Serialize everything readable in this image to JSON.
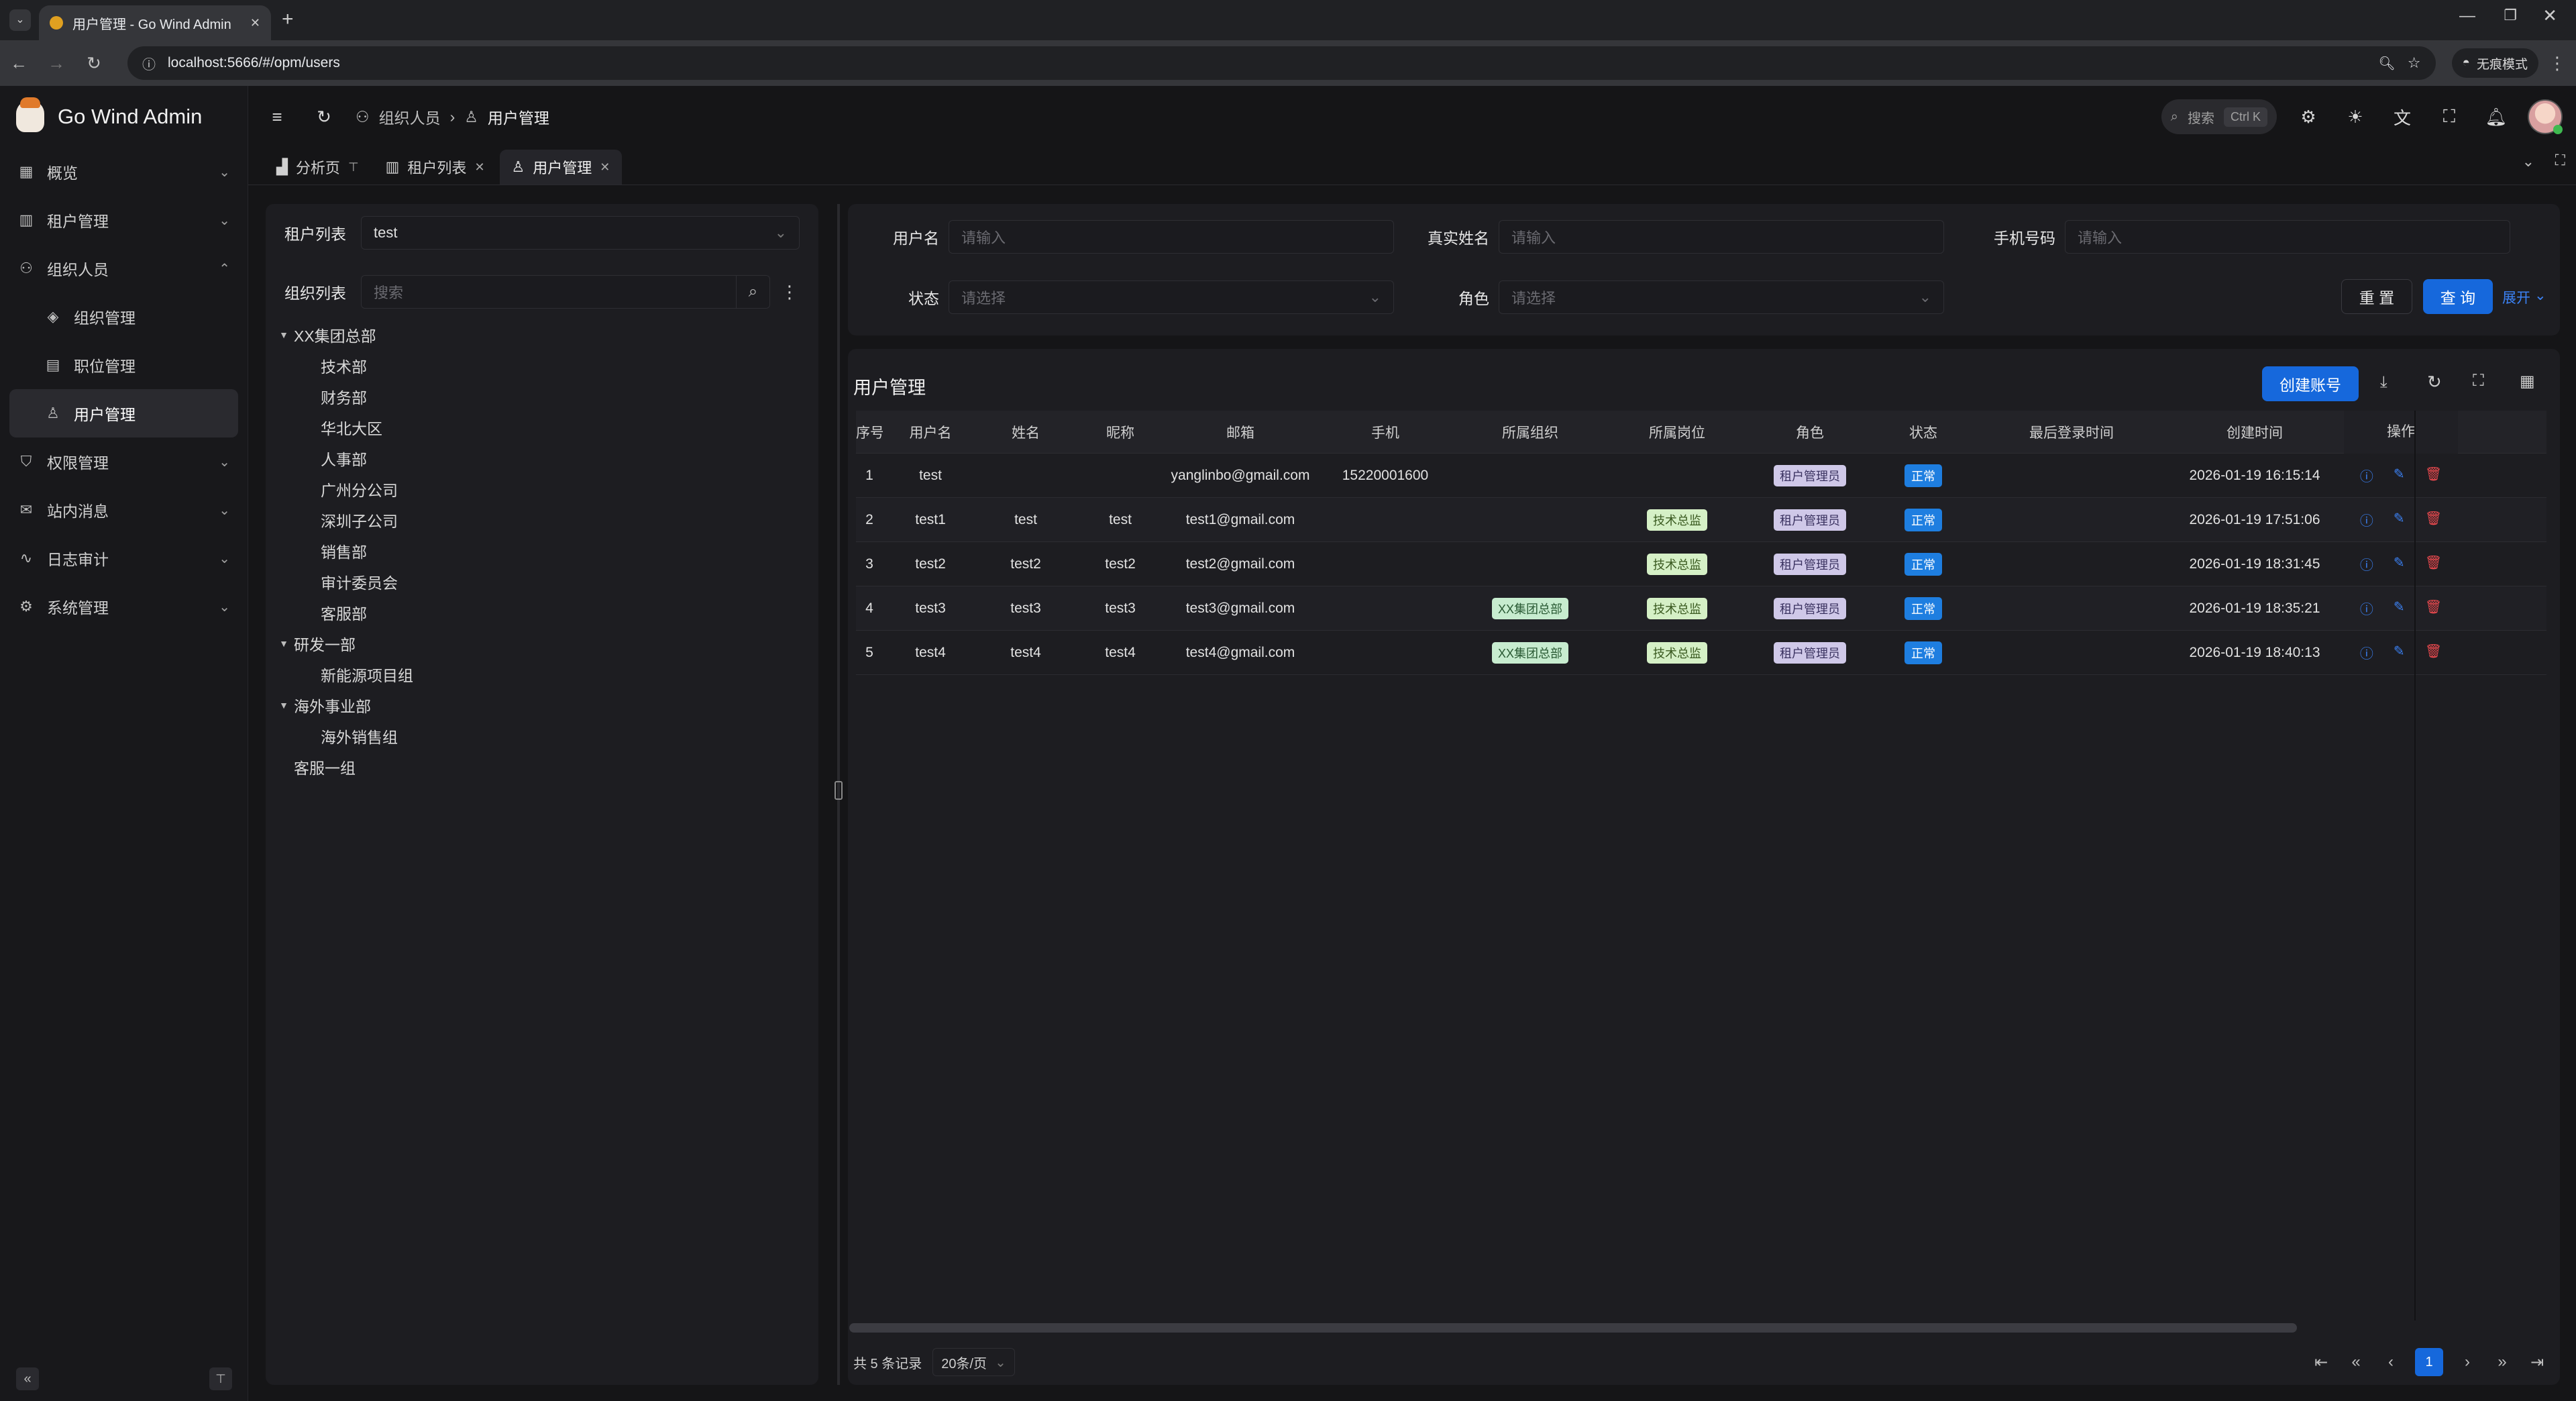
{
  "browser": {
    "tab_title": "用户管理 - Go Wind Admin",
    "url": "localhost:5666/#/opm/users",
    "incognito_label": "无痕模式",
    "new_tab": "+",
    "tab_close": "✕"
  },
  "app": {
    "name": "Go Wind Admin"
  },
  "sidebar": {
    "items": [
      {
        "label": "概览",
        "icon": "dashboard-icon",
        "expanded": false
      },
      {
        "label": "租户管理",
        "icon": "building-icon",
        "expanded": false
      },
      {
        "label": "组织人员",
        "icon": "users-icon",
        "expanded": true
      },
      {
        "label": "组织管理",
        "icon": "layers-icon",
        "sub": true
      },
      {
        "label": "职位管理",
        "icon": "briefcase-icon",
        "sub": true
      },
      {
        "label": "用户管理",
        "icon": "user-icon",
        "sub": true,
        "active": true
      },
      {
        "label": "权限管理",
        "icon": "shield-icon",
        "expanded": false
      },
      {
        "label": "站内消息",
        "icon": "mail-icon",
        "expanded": false
      },
      {
        "label": "日志审计",
        "icon": "pulse-icon",
        "expanded": false
      },
      {
        "label": "系统管理",
        "icon": "gear-icon",
        "expanded": false
      }
    ]
  },
  "header": {
    "breadcrumb_parent": "组织人员",
    "breadcrumb_current": "用户管理",
    "search_label": "搜索",
    "search_shortcut": "Ctrl K"
  },
  "tabs": [
    {
      "label": "分析页",
      "icon": "chart-icon",
      "pinned": true
    },
    {
      "label": "租户列表",
      "icon": "building-icon"
    },
    {
      "label": "用户管理",
      "icon": "user-icon",
      "active": true
    }
  ],
  "left_panel": {
    "tenant_label": "租户列表",
    "tenant_value": "test",
    "org_label": "组织列表",
    "org_search_placeholder": "搜索",
    "tree": [
      {
        "label": "XX集团总部",
        "level": 0,
        "toggle": true
      },
      {
        "label": "技术部",
        "level": 1
      },
      {
        "label": "财务部",
        "level": 1
      },
      {
        "label": "华北大区",
        "level": 1
      },
      {
        "label": "人事部",
        "level": 1
      },
      {
        "label": "广州分公司",
        "level": 1
      },
      {
        "label": "深圳子公司",
        "level": 1
      },
      {
        "label": "销售部",
        "level": 1
      },
      {
        "label": "审计委员会",
        "level": 1
      },
      {
        "label": "客服部",
        "level": 1
      },
      {
        "label": "研发一部",
        "level": 0,
        "toggle": true
      },
      {
        "label": "新能源项目组",
        "level": 1
      },
      {
        "label": "海外事业部",
        "level": 0,
        "toggle": true
      },
      {
        "label": "海外销售组",
        "level": 1
      },
      {
        "label": "客服一组",
        "level": 0
      }
    ]
  },
  "filter": {
    "username_label": "用户名",
    "realname_label": "真实姓名",
    "phone_label": "手机号码",
    "status_label": "状态",
    "role_label": "角色",
    "input_placeholder": "请输入",
    "select_placeholder": "请选择",
    "reset_label": "重 置",
    "query_label": "查 询",
    "expand_label": "展开"
  },
  "table": {
    "title": "用户管理",
    "create_label": "创建账号",
    "columns": [
      "序号",
      "用户名",
      "姓名",
      "昵称",
      "邮箱",
      "手机",
      "所属组织",
      "所属岗位",
      "角色",
      "状态",
      "最后登录时间",
      "创建时间",
      "操作"
    ],
    "rows": [
      {
        "no": "1",
        "username": "test",
        "name": "",
        "nickname": "",
        "email": "yanglinbo@gmail.com",
        "phone": "15220001600",
        "org": "",
        "position": "",
        "role": "租户管理员",
        "status": "正常",
        "last_login": "",
        "created": "2026-01-19 16:15:14"
      },
      {
        "no": "2",
        "username": "test1",
        "name": "test",
        "nickname": "test",
        "email": "test1@gmail.com",
        "phone": "",
        "org": "",
        "position": "技术总监",
        "role": "租户管理员",
        "status": "正常",
        "last_login": "",
        "created": "2026-01-19 17:51:06"
      },
      {
        "no": "3",
        "username": "test2",
        "name": "test2",
        "nickname": "test2",
        "email": "test2@gmail.com",
        "phone": "",
        "org": "",
        "position": "技术总监",
        "role": "租户管理员",
        "status": "正常",
        "last_login": "",
        "created": "2026-01-19 18:31:45"
      },
      {
        "no": "4",
        "username": "test3",
        "name": "test3",
        "nickname": "test3",
        "email": "test3@gmail.com",
        "phone": "",
        "org": "XX集团总部",
        "position": "技术总监",
        "role": "租户管理员",
        "status": "正常",
        "last_login": "",
        "created": "2026-01-19 18:35:21"
      },
      {
        "no": "5",
        "username": "test4",
        "name": "test4",
        "nickname": "test4",
        "email": "test4@gmail.com",
        "phone": "",
        "org": "XX集团总部",
        "position": "技术总监",
        "role": "租户管理员",
        "status": "正常",
        "last_login": "",
        "created": "2026-01-19 18:40:13"
      }
    ]
  },
  "pager": {
    "total": "共 5 条记录",
    "page_size": "20条/页",
    "current_page": "1"
  },
  "colors": {
    "accent": "#1668dc",
    "danger": "#e5484d",
    "tag_org": "#c7eccf",
    "tag_position": "#d5f0c6",
    "tag_role": "#cfc8e8",
    "status_ok": "#1e7ee0"
  }
}
